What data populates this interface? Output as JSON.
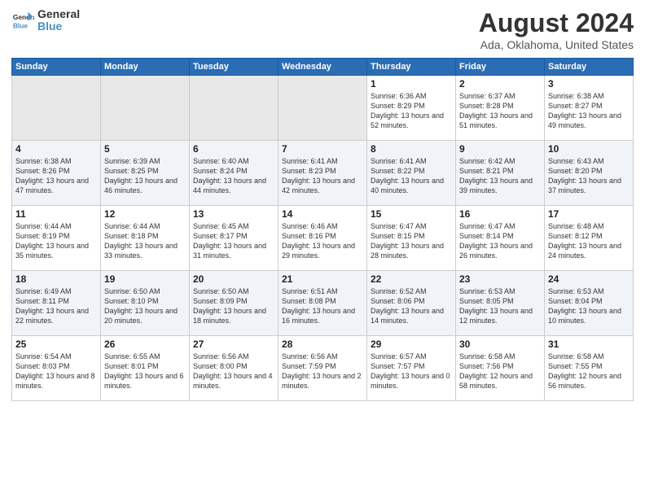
{
  "header": {
    "logo_line1": "General",
    "logo_line2": "Blue",
    "month_year": "August 2024",
    "location": "Ada, Oklahoma, United States"
  },
  "days_of_week": [
    "Sunday",
    "Monday",
    "Tuesday",
    "Wednesday",
    "Thursday",
    "Friday",
    "Saturday"
  ],
  "weeks": [
    [
      {
        "day": "",
        "empty": true
      },
      {
        "day": "",
        "empty": true
      },
      {
        "day": "",
        "empty": true
      },
      {
        "day": "",
        "empty": true
      },
      {
        "day": "1",
        "sunrise": "6:36 AM",
        "sunset": "8:29 PM",
        "daylight": "13 hours and 52 minutes."
      },
      {
        "day": "2",
        "sunrise": "6:37 AM",
        "sunset": "8:28 PM",
        "daylight": "13 hours and 51 minutes."
      },
      {
        "day": "3",
        "sunrise": "6:38 AM",
        "sunset": "8:27 PM",
        "daylight": "13 hours and 49 minutes."
      }
    ],
    [
      {
        "day": "4",
        "sunrise": "6:38 AM",
        "sunset": "8:26 PM",
        "daylight": "13 hours and 47 minutes."
      },
      {
        "day": "5",
        "sunrise": "6:39 AM",
        "sunset": "8:25 PM",
        "daylight": "13 hours and 46 minutes."
      },
      {
        "day": "6",
        "sunrise": "6:40 AM",
        "sunset": "8:24 PM",
        "daylight": "13 hours and 44 minutes."
      },
      {
        "day": "7",
        "sunrise": "6:41 AM",
        "sunset": "8:23 PM",
        "daylight": "13 hours and 42 minutes."
      },
      {
        "day": "8",
        "sunrise": "6:41 AM",
        "sunset": "8:22 PM",
        "daylight": "13 hours and 40 minutes."
      },
      {
        "day": "9",
        "sunrise": "6:42 AM",
        "sunset": "8:21 PM",
        "daylight": "13 hours and 39 minutes."
      },
      {
        "day": "10",
        "sunrise": "6:43 AM",
        "sunset": "8:20 PM",
        "daylight": "13 hours and 37 minutes."
      }
    ],
    [
      {
        "day": "11",
        "sunrise": "6:44 AM",
        "sunset": "8:19 PM",
        "daylight": "13 hours and 35 minutes."
      },
      {
        "day": "12",
        "sunrise": "6:44 AM",
        "sunset": "8:18 PM",
        "daylight": "13 hours and 33 minutes."
      },
      {
        "day": "13",
        "sunrise": "6:45 AM",
        "sunset": "8:17 PM",
        "daylight": "13 hours and 31 minutes."
      },
      {
        "day": "14",
        "sunrise": "6:46 AM",
        "sunset": "8:16 PM",
        "daylight": "13 hours and 29 minutes."
      },
      {
        "day": "15",
        "sunrise": "6:47 AM",
        "sunset": "8:15 PM",
        "daylight": "13 hours and 28 minutes."
      },
      {
        "day": "16",
        "sunrise": "6:47 AM",
        "sunset": "8:14 PM",
        "daylight": "13 hours and 26 minutes."
      },
      {
        "day": "17",
        "sunrise": "6:48 AM",
        "sunset": "8:12 PM",
        "daylight": "13 hours and 24 minutes."
      }
    ],
    [
      {
        "day": "18",
        "sunrise": "6:49 AM",
        "sunset": "8:11 PM",
        "daylight": "13 hours and 22 minutes."
      },
      {
        "day": "19",
        "sunrise": "6:50 AM",
        "sunset": "8:10 PM",
        "daylight": "13 hours and 20 minutes."
      },
      {
        "day": "20",
        "sunrise": "6:50 AM",
        "sunset": "8:09 PM",
        "daylight": "13 hours and 18 minutes."
      },
      {
        "day": "21",
        "sunrise": "6:51 AM",
        "sunset": "8:08 PM",
        "daylight": "13 hours and 16 minutes."
      },
      {
        "day": "22",
        "sunrise": "6:52 AM",
        "sunset": "8:06 PM",
        "daylight": "13 hours and 14 minutes."
      },
      {
        "day": "23",
        "sunrise": "6:53 AM",
        "sunset": "8:05 PM",
        "daylight": "13 hours and 12 minutes."
      },
      {
        "day": "24",
        "sunrise": "6:53 AM",
        "sunset": "8:04 PM",
        "daylight": "13 hours and 10 minutes."
      }
    ],
    [
      {
        "day": "25",
        "sunrise": "6:54 AM",
        "sunset": "8:03 PM",
        "daylight": "13 hours and 8 minutes."
      },
      {
        "day": "26",
        "sunrise": "6:55 AM",
        "sunset": "8:01 PM",
        "daylight": "13 hours and 6 minutes."
      },
      {
        "day": "27",
        "sunrise": "6:56 AM",
        "sunset": "8:00 PM",
        "daylight": "13 hours and 4 minutes."
      },
      {
        "day": "28",
        "sunrise": "6:56 AM",
        "sunset": "7:59 PM",
        "daylight": "13 hours and 2 minutes."
      },
      {
        "day": "29",
        "sunrise": "6:57 AM",
        "sunset": "7:57 PM",
        "daylight": "13 hours and 0 minutes."
      },
      {
        "day": "30",
        "sunrise": "6:58 AM",
        "sunset": "7:56 PM",
        "daylight": "12 hours and 58 minutes."
      },
      {
        "day": "31",
        "sunrise": "6:58 AM",
        "sunset": "7:55 PM",
        "daylight": "12 hours and 56 minutes."
      }
    ]
  ]
}
